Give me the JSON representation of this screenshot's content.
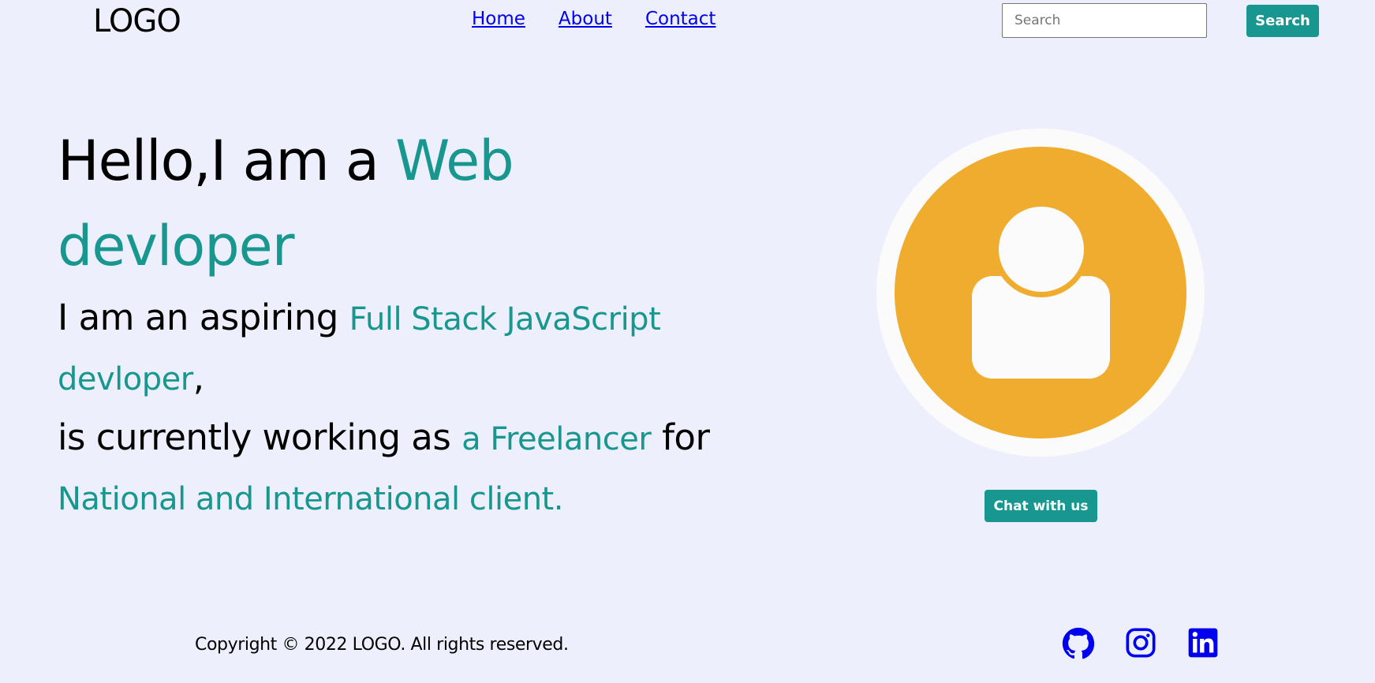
{
  "header": {
    "logo": "LOGO",
    "nav": [
      "Home",
      "About",
      "Contact"
    ],
    "search_placeholder": "Search",
    "search_button": "Search"
  },
  "hero": {
    "title_part1": "Hello,I am a ",
    "title_accent_line1": "Web",
    "title_accent_line2": "devloper",
    "line1_text": "I am an aspiring ",
    "line1_highlight": "Full Stack JavaScript",
    "line2_highlight": "devloper",
    "line2_text": ",",
    "line3_text": "is currently working as ",
    "line3_highlight": "a Freelancer",
    "line3_text_end": " for",
    "line4_highlight": "National and International client."
  },
  "profile": {
    "avatar_icon": "user-icon",
    "chat_button": "Chat with us"
  },
  "footer": {
    "copyright": "Copyright © 2022 LOGO. All rights reserved.",
    "social_icons": [
      "github-icon",
      "instagram-icon",
      "linkedin-icon"
    ]
  },
  "colors": {
    "accent": "#17978f",
    "avatar_bg": "#f0ac2e",
    "page_bg": "#edf0fc",
    "link": "#0000ee"
  }
}
